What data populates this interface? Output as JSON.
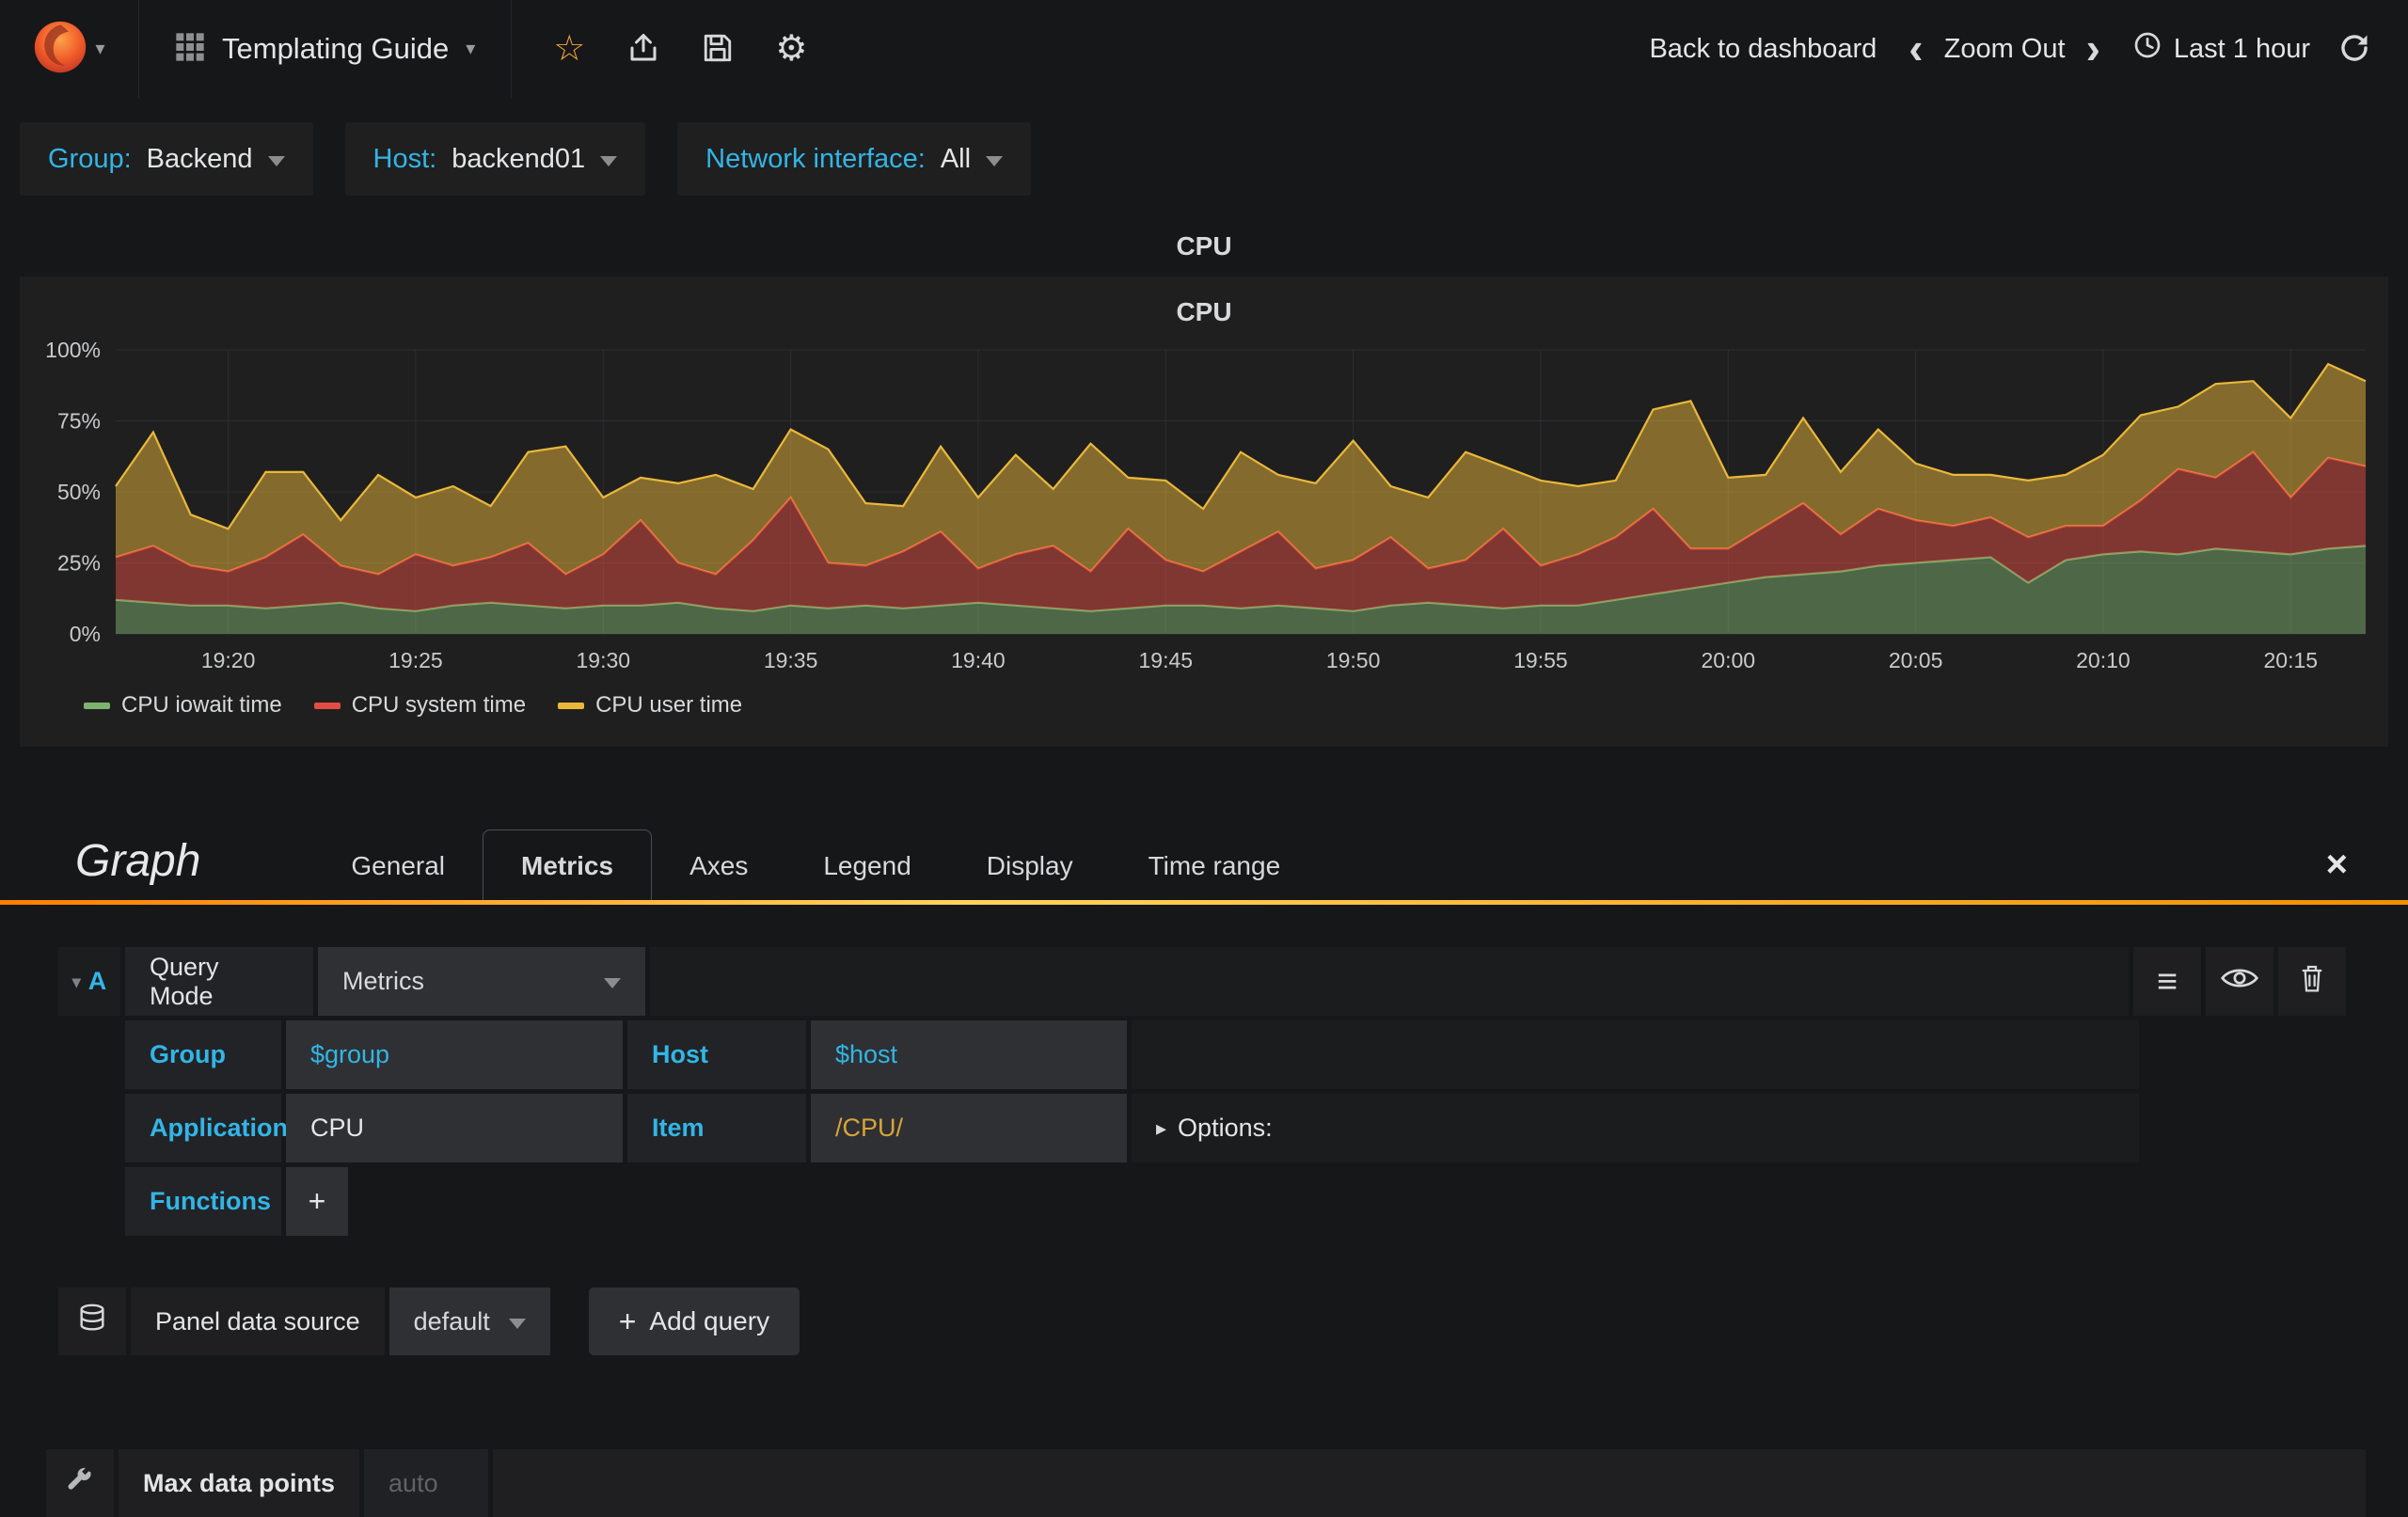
{
  "icons": {
    "caret_down": "▾",
    "caret_right": "▸",
    "star": "☆",
    "gear": "⚙",
    "close": "×",
    "menu": "≡",
    "plus": "+",
    "chevron_left": "‹",
    "chevron_right": "›"
  },
  "navbar": {
    "title": "Templating Guide",
    "back_to_dashboard": "Back to dashboard",
    "zoom_out": "Zoom Out",
    "time_range": "Last 1 hour"
  },
  "template_vars": [
    {
      "label": "Group:",
      "value": "Backend"
    },
    {
      "label": "Host:",
      "value": "backend01"
    },
    {
      "label": "Network interface:",
      "value": "All"
    }
  ],
  "panel": {
    "header_title": "CPU"
  },
  "chart_data": {
    "type": "area",
    "stacked": true,
    "title": "CPU",
    "xlabel": "",
    "ylabel": "",
    "ylim": [
      0,
      100
    ],
    "grid": true,
    "legend_position": "bottom-left",
    "y_ticks": [
      "0%",
      "25%",
      "50%",
      "75%",
      "100%"
    ],
    "y_tick_values": [
      0,
      25,
      50,
      75,
      100
    ],
    "x_ticks": [
      "19:20",
      "19:25",
      "19:30",
      "19:35",
      "19:40",
      "19:45",
      "19:50",
      "19:55",
      "20:00",
      "20:05",
      "20:10",
      "20:15"
    ],
    "x_tick_indices": [
      3,
      8,
      13,
      18,
      23,
      28,
      33,
      38,
      43,
      48,
      53,
      58
    ],
    "x_range": "19:17 - 20:17 (Last 1 hour, 1 point per minute)",
    "series": [
      {
        "name": "CPU iowait time",
        "color": "#7EB26D",
        "values": [
          12,
          11,
          10,
          10,
          9,
          10,
          11,
          9,
          8,
          10,
          11,
          10,
          9,
          10,
          10,
          11,
          9,
          8,
          10,
          9,
          10,
          9,
          10,
          11,
          10,
          9,
          8,
          9,
          10,
          10,
          9,
          10,
          9,
          8,
          10,
          11,
          10,
          9,
          10,
          10,
          12,
          14,
          16,
          18,
          20,
          21,
          22,
          24,
          25,
          26,
          27,
          18,
          26,
          28,
          29,
          28,
          30,
          29,
          28,
          30,
          31
        ]
      },
      {
        "name": "CPU system time",
        "color": "#E24D42",
        "values": [
          15,
          20,
          14,
          12,
          18,
          25,
          13,
          12,
          20,
          14,
          16,
          22,
          12,
          18,
          30,
          14,
          12,
          25,
          38,
          16,
          14,
          20,
          26,
          12,
          18,
          22,
          14,
          28,
          16,
          12,
          20,
          26,
          14,
          18,
          24,
          12,
          16,
          28,
          14,
          18,
          22,
          30,
          14,
          12,
          18,
          25,
          13,
          20,
          15,
          12,
          14,
          16,
          12,
          10,
          18,
          30,
          25,
          35,
          20,
          32,
          28
        ]
      },
      {
        "name": "CPU user time",
        "color": "#EAB839",
        "values": [
          25,
          40,
          18,
          15,
          30,
          22,
          16,
          35,
          20,
          28,
          18,
          32,
          45,
          20,
          15,
          28,
          35,
          18,
          24,
          40,
          22,
          16,
          30,
          25,
          35,
          20,
          45,
          18,
          28,
          22,
          35,
          20,
          30,
          42,
          18,
          25,
          38,
          22,
          30,
          24,
          20,
          35,
          52,
          25,
          18,
          30,
          22,
          28,
          20,
          18,
          15,
          20,
          18,
          25,
          30,
          22,
          33,
          25,
          28,
          33,
          30
        ]
      }
    ]
  },
  "editor": {
    "panel_type_label": "Graph",
    "tabs": [
      "General",
      "Metrics",
      "Axes",
      "Legend",
      "Display",
      "Time range"
    ],
    "active_tab": "Metrics",
    "query": {
      "ref": "A",
      "mode_label": "Query Mode",
      "mode_value": "Metrics",
      "group_label": "Group",
      "group_value": "$group",
      "host_label": "Host",
      "host_value": "$host",
      "app_label": "Application",
      "app_value": "CPU",
      "item_label": "Item",
      "item_value": "/CPU/",
      "options_label": "Options:",
      "functions_label": "Functions"
    },
    "datasource": {
      "label": "Panel data source",
      "value": "default",
      "add_query_label": "Add query"
    },
    "max_data_points": {
      "label": "Max data points",
      "placeholder": "auto"
    }
  }
}
